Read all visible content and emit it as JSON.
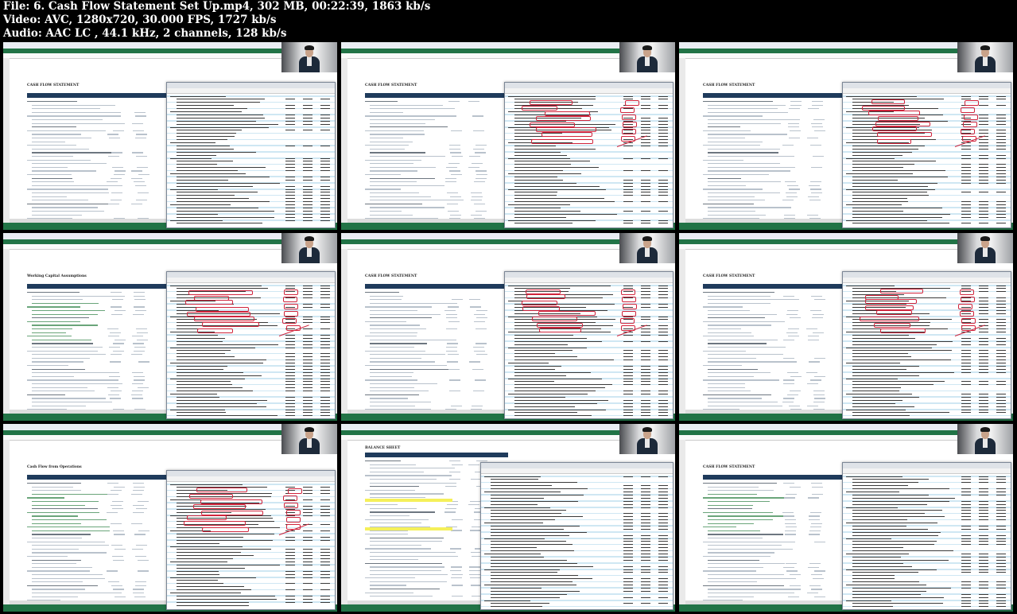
{
  "file_info": {
    "file_line": "File: 6. Cash Flow Statement Set Up.mp4, 302 MB, 00:22:39, 1863 kb/s",
    "video_line": "Video: AVC, 1280x720, 30.000 FPS, 1727 kb/s",
    "audio_line": "Audio: AAC LC , 44.1 kHz, 2 channels, 128 kb/s"
  },
  "thumbnails": [
    {
      "id": 1,
      "sheet_title": "CASH FLOW STATEMENT",
      "overlay": "pdf"
    },
    {
      "id": 2,
      "sheet_title": "CASH FLOW STATEMENT",
      "overlay": "pdf-annotated"
    },
    {
      "id": 3,
      "sheet_title": "CASH FLOW STATEMENT",
      "overlay": "pdf-annotated"
    },
    {
      "id": 4,
      "sheet_title": "Working Capital Assumptions",
      "overlay": "pdf-annotated"
    },
    {
      "id": 5,
      "sheet_title": "CASH FLOW STATEMENT",
      "overlay": "pdf-annotated"
    },
    {
      "id": 6,
      "sheet_title": "CASH FLOW STATEMENT",
      "overlay": "pdf-annotated"
    },
    {
      "id": 7,
      "sheet_title": "Cash Flow from Operations",
      "overlay": "pdf-annotated"
    },
    {
      "id": 8,
      "sheet_title": "BALANCE SHEET",
      "overlay": "pdf"
    },
    {
      "id": 9,
      "sheet_title": "CASH FLOW STATEMENT",
      "overlay": "pdf"
    }
  ],
  "colors": {
    "excel_green": "#217346",
    "header_navy": "#1f3b5c",
    "annotation_red": "#d0243c",
    "highlight_yellow": "#f5f05a"
  }
}
